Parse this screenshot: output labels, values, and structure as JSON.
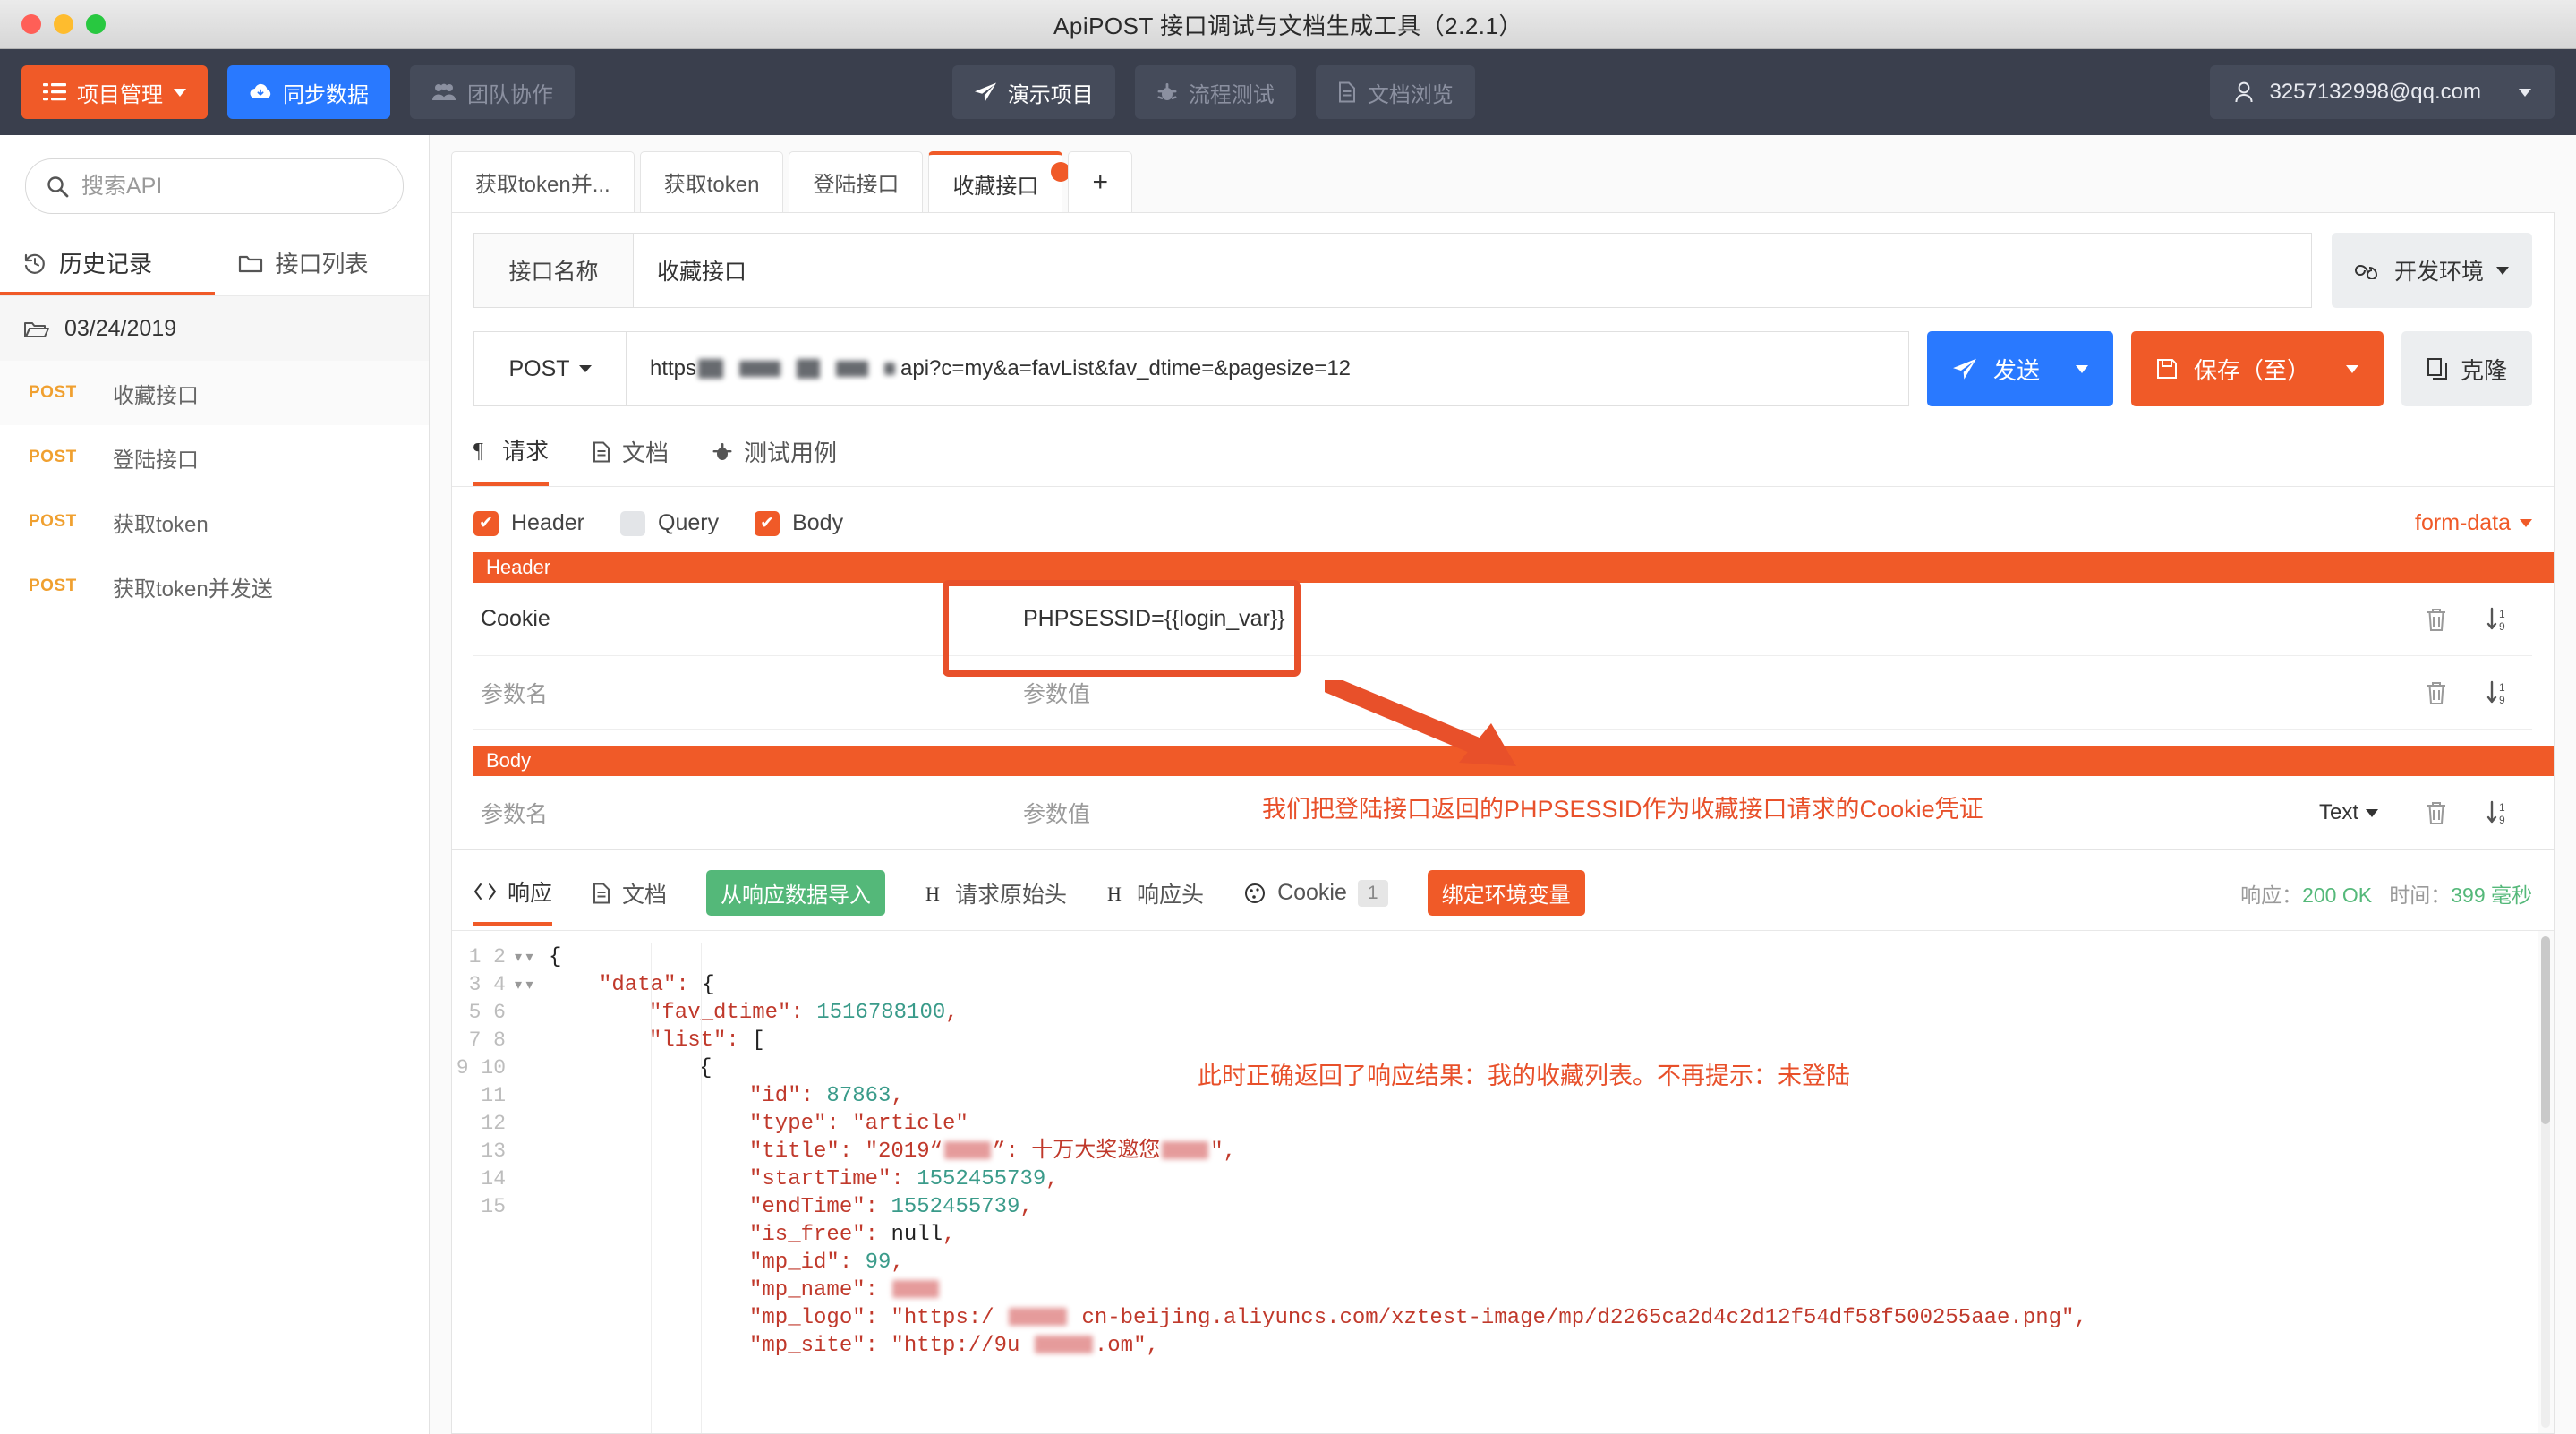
{
  "window": {
    "title": "ApiPOST 接口调试与文档生成工具（2.2.1）"
  },
  "toolbar": {
    "project_manage": "项目管理",
    "sync_data": "同步数据",
    "team_collab": "团队协作",
    "demo_project": "演示项目",
    "flow_test": "流程测试",
    "doc_browse": "文档浏览",
    "account": "3257132998@qq.com"
  },
  "sidebar": {
    "search_placeholder": "搜索API",
    "tabs": [
      {
        "label": "历史记录",
        "icon": "history-icon",
        "active": true
      },
      {
        "label": "接口列表",
        "icon": "folder-icon",
        "active": false
      }
    ],
    "folder": "03/24/2019",
    "items": [
      {
        "method": "POST",
        "label": "收藏接口",
        "selected": true
      },
      {
        "method": "POST",
        "label": "登陆接口",
        "selected": false
      },
      {
        "method": "POST",
        "label": "获取token",
        "selected": false
      },
      {
        "method": "POST",
        "label": "获取token并发送",
        "selected": false
      }
    ]
  },
  "tabs": [
    {
      "label": "获取token并...",
      "active": false,
      "dirty": false
    },
    {
      "label": "获取token",
      "active": false,
      "dirty": false
    },
    {
      "label": "登陆接口",
      "active": false,
      "dirty": false
    },
    {
      "label": "收藏接口",
      "active": true,
      "dirty": true
    },
    {
      "label": "+",
      "active": false,
      "dirty": false
    }
  ],
  "request": {
    "name_label": "接口名称",
    "name_value": "收藏接口",
    "env_label": "开发环境",
    "method": "POST",
    "url_prefix": "https",
    "url_suffix": "api?c=my&a=favList&fav_dtime=&pagesize=12",
    "send_label": "发送",
    "save_label": "保存（至）",
    "clone_label": "克隆",
    "tabs": [
      {
        "label": "请求",
        "icon": "paragraph-icon",
        "active": true
      },
      {
        "label": "文档",
        "icon": "doc-icon",
        "active": false
      },
      {
        "label": "测试用例",
        "icon": "bug-icon",
        "active": false
      }
    ],
    "checkboxes": [
      {
        "label": "Header",
        "checked": true
      },
      {
        "label": "Query",
        "checked": false
      },
      {
        "label": "Body",
        "checked": true
      }
    ],
    "body_type": "form-data",
    "value_type": "Text",
    "header_section": "Header",
    "body_section": "Body",
    "param_name_placeholder": "参数名",
    "param_value_placeholder": "参数值",
    "header_rows": [
      {
        "name": "Cookie",
        "value": "PHPSESSID={{login_var}}",
        "highlighted": true
      },
      {
        "name": "参数名",
        "value": "参数值",
        "highlighted": false
      }
    ],
    "body_rows": [
      {
        "name": "参数名",
        "value": "参数值",
        "highlighted": false
      }
    ]
  },
  "response": {
    "tabs": [
      {
        "label": "响应",
        "icon": "code-icon",
        "active": true,
        "kind": "tab"
      },
      {
        "label": "文档",
        "icon": "doc-icon",
        "active": false,
        "kind": "tab"
      },
      {
        "label": "从响应数据导入",
        "active": false,
        "kind": "pill-green"
      },
      {
        "label": "请求原始头",
        "icon": "header-icon",
        "active": false,
        "kind": "tab"
      },
      {
        "label": "响应头",
        "icon": "header-icon",
        "active": false,
        "kind": "tab"
      },
      {
        "label": "Cookie",
        "icon": "cookie-icon",
        "active": false,
        "kind": "tab",
        "count": "1"
      },
      {
        "label": "绑定环境变量",
        "active": false,
        "kind": "pill-orange"
      }
    ],
    "status_prefix": "响应：",
    "status": "200 OK",
    "time_prefix": "时间：",
    "time": "399 毫秒",
    "lines": [
      {
        "n": "1",
        "fold": true,
        "indent": 0,
        "text": "{"
      },
      {
        "n": "2",
        "fold": true,
        "indent": 1,
        "text": "\"data\": {"
      },
      {
        "n": "3",
        "fold": false,
        "indent": 2,
        "text": "\"fav_dtime\": 1516788100,"
      },
      {
        "n": "4",
        "fold": true,
        "indent": 2,
        "text": "\"list\": ["
      },
      {
        "n": "5",
        "fold": true,
        "indent": 3,
        "text": "{"
      },
      {
        "n": "6",
        "fold": false,
        "indent": 4,
        "text": "\"id\": 87863,"
      },
      {
        "n": "7",
        "fold": false,
        "indent": 4,
        "text": "\"type\": \"article\""
      },
      {
        "n": "8",
        "fold": false,
        "indent": 4,
        "text": "\"title\": \"2019“▮▮▮▮”: 十万大奖邀您▮▮▮▮\","
      },
      {
        "n": "9",
        "fold": false,
        "indent": 4,
        "text": "\"startTime\": 1552455739,"
      },
      {
        "n": "10",
        "fold": false,
        "indent": 4,
        "text": "\"endTime\": 1552455739,"
      },
      {
        "n": "11",
        "fold": false,
        "indent": 4,
        "text": "\"is_free\": null,"
      },
      {
        "n": "12",
        "fold": false,
        "indent": 4,
        "text": "\"mp_id\": 99,"
      },
      {
        "n": "13",
        "fold": false,
        "indent": 4,
        "text": "\"mp_name\": ▮▮▮▮"
      },
      {
        "n": "14",
        "fold": false,
        "indent": 4,
        "text": "\"mp_logo\": \"https:/ ▮▮▮▮▮ cn-beijing.aliyuncs.com/xztest-image/mp/d2265ca2d4c2d12f54df58f500255aae.png\","
      },
      {
        "n": "15",
        "fold": false,
        "indent": 4,
        "text": "\"mp_site\": \"http://9u ▮▮▮▮▮.om\","
      }
    ]
  },
  "annotations": [
    {
      "id": "cookie-box",
      "type": "box"
    },
    {
      "id": "cookie-arrow",
      "type": "arrow"
    },
    {
      "id": "cookie-note",
      "type": "text",
      "text": "我们把登陆接口返回的PHPSESSID作为收藏接口请求的Cookie凭证"
    },
    {
      "id": "response-note",
      "type": "text",
      "text": "此时正确返回了响应结果：我的收藏列表。不再提示：未登陆"
    }
  ],
  "colors": {
    "accent": "#f05a28",
    "blue": "#2979ff",
    "green": "#54b879",
    "dark": "#3a3f4d",
    "annotation": "#e8502a"
  }
}
